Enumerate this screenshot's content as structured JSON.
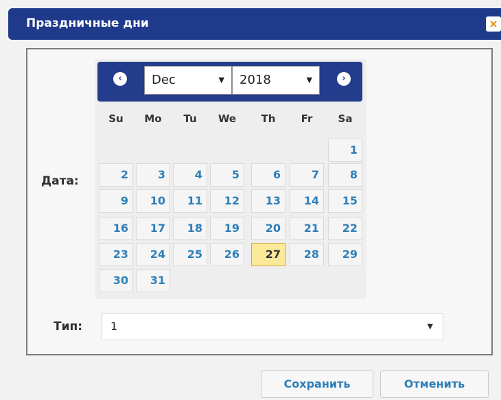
{
  "dialog": {
    "title": "Праздничные дни",
    "close_icon": "×"
  },
  "form": {
    "date_label": "Дата:",
    "type_label": "Тип:",
    "type_value": "1"
  },
  "calendar": {
    "prev_icon": "‹",
    "next_icon": "›",
    "month": "Dec",
    "year": "2018",
    "weekdays": [
      "Su",
      "Mo",
      "Tu",
      "We",
      "Th",
      "Fr",
      "Sa"
    ],
    "selected_day": "27",
    "weeks": [
      [
        "",
        "",
        "",
        "",
        "",
        "",
        "1"
      ],
      [
        "2",
        "3",
        "4",
        "5",
        "6",
        "7",
        "8"
      ],
      [
        "9",
        "10",
        "11",
        "12",
        "13",
        "14",
        "15"
      ],
      [
        "16",
        "17",
        "18",
        "19",
        "20",
        "21",
        "22"
      ],
      [
        "23",
        "24",
        "25",
        "26",
        "27",
        "28",
        "29"
      ],
      [
        "30",
        "31",
        "",
        "",
        "",
        "",
        ""
      ]
    ]
  },
  "buttons": {
    "save": "Сохранить",
    "cancel": "Отменить"
  },
  "colors": {
    "header": "#233c8c",
    "link": "#2e7fb8",
    "today": "#fde99a"
  }
}
